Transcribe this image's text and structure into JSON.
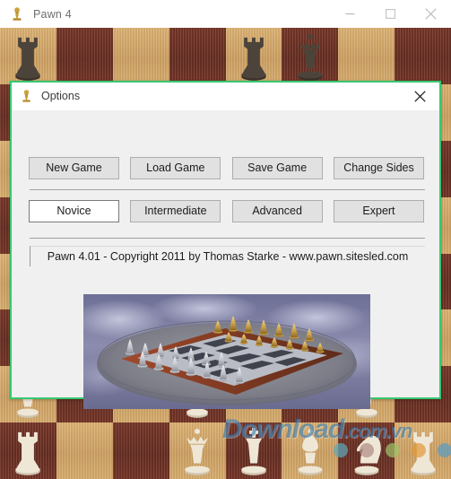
{
  "main_window": {
    "title": "Pawn 4",
    "icon": "pawn-icon",
    "controls": {
      "minimize": "minimize-icon",
      "maximize": "maximize-icon",
      "close": "close-icon"
    }
  },
  "dialog": {
    "title": "Options",
    "icon": "pawn-icon",
    "close_label": "close-icon",
    "accent_border_color": "#37c871",
    "action_buttons": [
      {
        "label": "New Game",
        "selected": false
      },
      {
        "label": "Load Game",
        "selected": false
      },
      {
        "label": "Save Game",
        "selected": false
      },
      {
        "label": "Change Sides",
        "selected": false
      }
    ],
    "difficulty_buttons": [
      {
        "label": "Novice",
        "selected": true
      },
      {
        "label": "Intermediate",
        "selected": false
      },
      {
        "label": "Advanced",
        "selected": false
      },
      {
        "label": "Expert",
        "selected": false
      }
    ],
    "copyright": "Pawn 4.01  -  Copyright 2011 by Thomas Starke  -  www.pawn.sitesled.com",
    "preview_image_alt": "3D rendered chess board with gold and silver pieces on a stone platform"
  },
  "background": {
    "type": "chess-board",
    "light_square_color": "#d2a86a",
    "dark_square_color": "#7a3b2e",
    "dark_piece_color": "#4c443a",
    "light_piece_color": "#efe7d6"
  },
  "watermark": {
    "text_main": "Download",
    "text_suffix": ".com.vn",
    "color": "#1e6eaa"
  }
}
